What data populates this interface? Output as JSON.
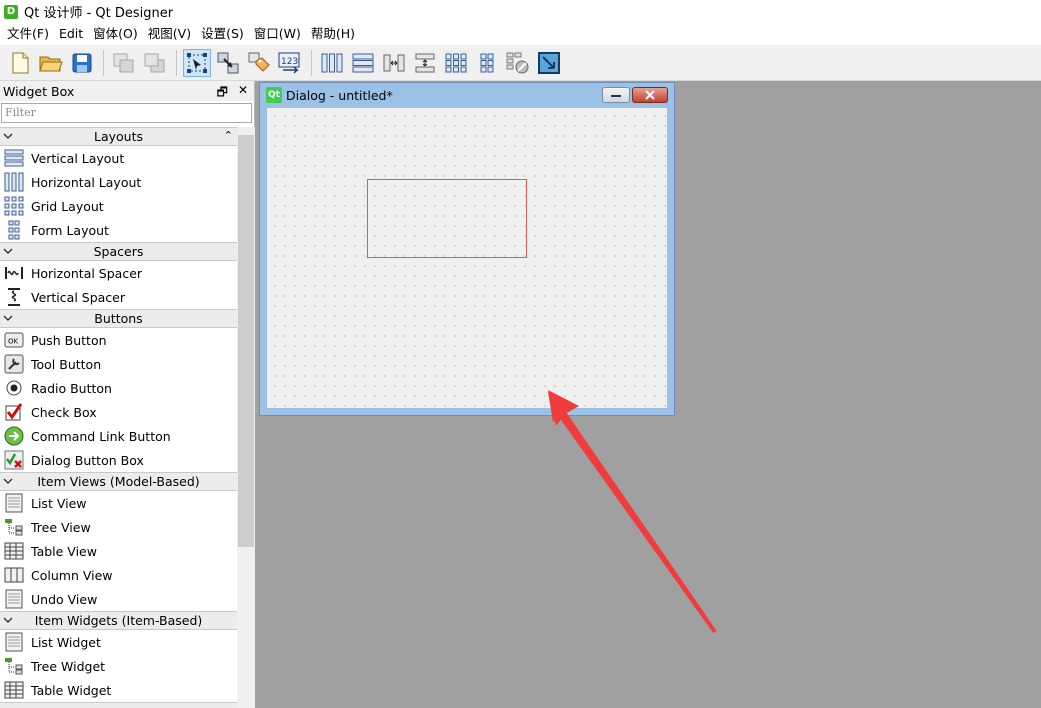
{
  "window": {
    "app_icon": "D",
    "title": "Qt 设计师 - Qt Designer"
  },
  "menu": [
    "文件(F)",
    "Edit",
    "窗体(O)",
    "视图(V)",
    "设置(S)",
    "窗口(W)",
    "帮助(H)"
  ],
  "toolbar": {
    "icons": [
      "new-file-icon",
      "open-folder-icon",
      "save-icon",
      "send-to-back-icon",
      "bring-to-front-icon",
      "edit-widgets-icon",
      "edit-signals-slots-icon",
      "edit-buddies-icon",
      "edit-tab-order-icon",
      "layout-horizontal-icon",
      "layout-vertical-icon",
      "layout-horizontal-splitter-icon",
      "layout-vertical-splitter-icon",
      "layout-grid-icon",
      "layout-form-icon",
      "break-layout-icon",
      "adjust-size-icon"
    ]
  },
  "widget_box": {
    "title": "Widget Box",
    "filter_placeholder": "Filter",
    "categories": [
      {
        "label": "Layouts",
        "items": [
          {
            "label": "Vertical Layout",
            "icon": "vertical-layout-icon"
          },
          {
            "label": "Horizontal Layout",
            "icon": "horizontal-layout-icon"
          },
          {
            "label": "Grid Layout",
            "icon": "grid-layout-icon"
          },
          {
            "label": "Form Layout",
            "icon": "form-layout-icon"
          }
        ]
      },
      {
        "label": "Spacers",
        "items": [
          {
            "label": "Horizontal Spacer",
            "icon": "horizontal-spacer-icon"
          },
          {
            "label": "Vertical Spacer",
            "icon": "vertical-spacer-icon"
          }
        ]
      },
      {
        "label": "Buttons",
        "items": [
          {
            "label": "Push Button",
            "icon": "push-button-icon"
          },
          {
            "label": "Tool Button",
            "icon": "tool-button-icon"
          },
          {
            "label": "Radio Button",
            "icon": "radio-button-icon"
          },
          {
            "label": "Check Box",
            "icon": "check-box-icon"
          },
          {
            "label": "Command Link Button",
            "icon": "command-link-icon"
          },
          {
            "label": "Dialog Button Box",
            "icon": "dialog-button-box-icon"
          }
        ]
      },
      {
        "label": "Item Views (Model-Based)",
        "items": [
          {
            "label": "List View",
            "icon": "list-view-icon"
          },
          {
            "label": "Tree View",
            "icon": "tree-view-icon"
          },
          {
            "label": "Table View",
            "icon": "table-view-icon"
          },
          {
            "label": "Column View",
            "icon": "column-view-icon"
          },
          {
            "label": "Undo View",
            "icon": "undo-view-icon"
          }
        ]
      },
      {
        "label": "Item Widgets (Item-Based)",
        "items": [
          {
            "label": "List Widget",
            "icon": "list-widget-icon"
          },
          {
            "label": "Tree Widget",
            "icon": "tree-widget-icon"
          },
          {
            "label": "Table Widget",
            "icon": "table-widget-icon"
          }
        ]
      }
    ]
  },
  "dialog": {
    "icon": "Qt",
    "title": "Dialog - untitled*"
  },
  "colors": {
    "selection_outline": "#e05a5a",
    "annotation_arrow": "#f03c3c"
  }
}
